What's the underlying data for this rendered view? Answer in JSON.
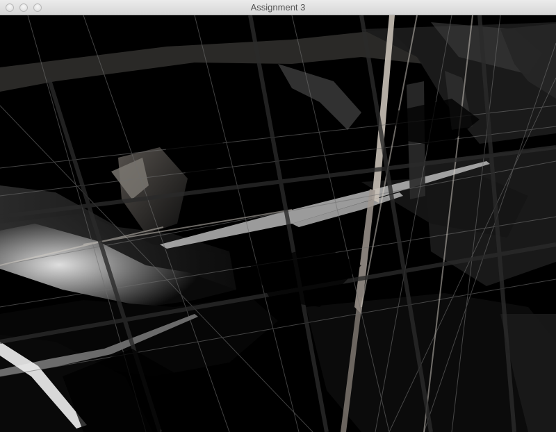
{
  "window": {
    "title": "Assignment 3",
    "buttons": {
      "close": "close-icon",
      "minimize": "minimize-icon",
      "zoom": "zoom-icon"
    }
  },
  "viewport": {
    "background_color": "#000000",
    "description_colors": {
      "highlight": "#dcd8d0",
      "mid_gray": "#8f8a84",
      "dark_gray": "#2a2a2a"
    }
  }
}
